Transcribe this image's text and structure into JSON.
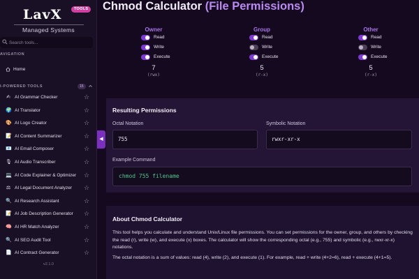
{
  "brand": {
    "logo": "LavX",
    "badge": "TOOLS",
    "subtitle": "Managed Systems"
  },
  "search": {
    "placeholder": "Search tools..."
  },
  "nav": {
    "section_label": "AVIGATION",
    "home_label": "Home"
  },
  "tools": {
    "section_label": "I-POWERED TOOLS",
    "count": "15",
    "items": [
      {
        "label": "AI Grammar Checker",
        "icon": "✍"
      },
      {
        "label": "AI Translator",
        "icon": "🌍"
      },
      {
        "label": "AI Logo Creator",
        "icon": "🎨"
      },
      {
        "label": "AI Content Summarizer",
        "icon": "📝"
      },
      {
        "label": "AI Email Composer",
        "icon": "📧"
      },
      {
        "label": "AI Audio Transcriber",
        "icon": "🎙"
      },
      {
        "label": "AI Code Explainer & Optimizer",
        "icon": "💻"
      },
      {
        "label": "AI Legal Document Analyzer",
        "icon": "⚖"
      },
      {
        "label": "AI Research Assistant",
        "icon": "🔍"
      },
      {
        "label": "AI Job Description Generator",
        "icon": "📝"
      },
      {
        "label": "AI HR Match Analyzer",
        "icon": "🧠"
      },
      {
        "label": "AI SEO Audit Tool",
        "icon": "🔍"
      },
      {
        "label": "AI Contract Generator",
        "icon": "📄"
      }
    ]
  },
  "version": "v2.1.0",
  "page": {
    "title_main": "Chmod Calculator",
    "title_accent": "(File Permissions)"
  },
  "permissions": [
    {
      "group": "Owner",
      "read": {
        "label": "Read",
        "on": true
      },
      "write": {
        "label": "Write",
        "on": true
      },
      "execute": {
        "label": "Execute",
        "on": true
      },
      "digit": "7",
      "symbolic": "(rwx)"
    },
    {
      "group": "Group",
      "read": {
        "label": "Read",
        "on": true
      },
      "write": {
        "label": "Write",
        "on": false
      },
      "execute": {
        "label": "Execute",
        "on": true
      },
      "digit": "5",
      "symbolic": "(r-x)"
    },
    {
      "group": "Other",
      "read": {
        "label": "Read",
        "on": true
      },
      "write": {
        "label": "Write",
        "on": false
      },
      "execute": {
        "label": "Execute",
        "on": true
      },
      "digit": "5",
      "symbolic": "(r-x)"
    }
  ],
  "result": {
    "title": "Resulting Permissions",
    "octal_label": "Octal Notation",
    "octal_value": "755",
    "symbolic_label": "Symbolic Notation",
    "symbolic_value": "rwxr-xr-x",
    "command_label": "Example Command",
    "command_value": "chmod 755 filename"
  },
  "about": {
    "title": "About Chmod Calculator",
    "p1": "This tool helps you calculate and understand Unix/Linux file permissions. You can set permissions for the owner, group, and others by checking the read (r), write (w), and execute (x) boxes. The calculator will show the corresponding octal (e.g., 755) and symbolic (e.g., rwxr-xr-x) notations.",
    "p2": "The octal notation is a sum of values: read (4), write (2), and execute (1). For example, read + write (4+2=6), read + execute (4+1=5)."
  },
  "colors": {
    "accent": "#b98af0",
    "toggle_on": "#7d3ad0",
    "command_text": "#4fc98a",
    "sidebar_bg": "#1a1026"
  }
}
